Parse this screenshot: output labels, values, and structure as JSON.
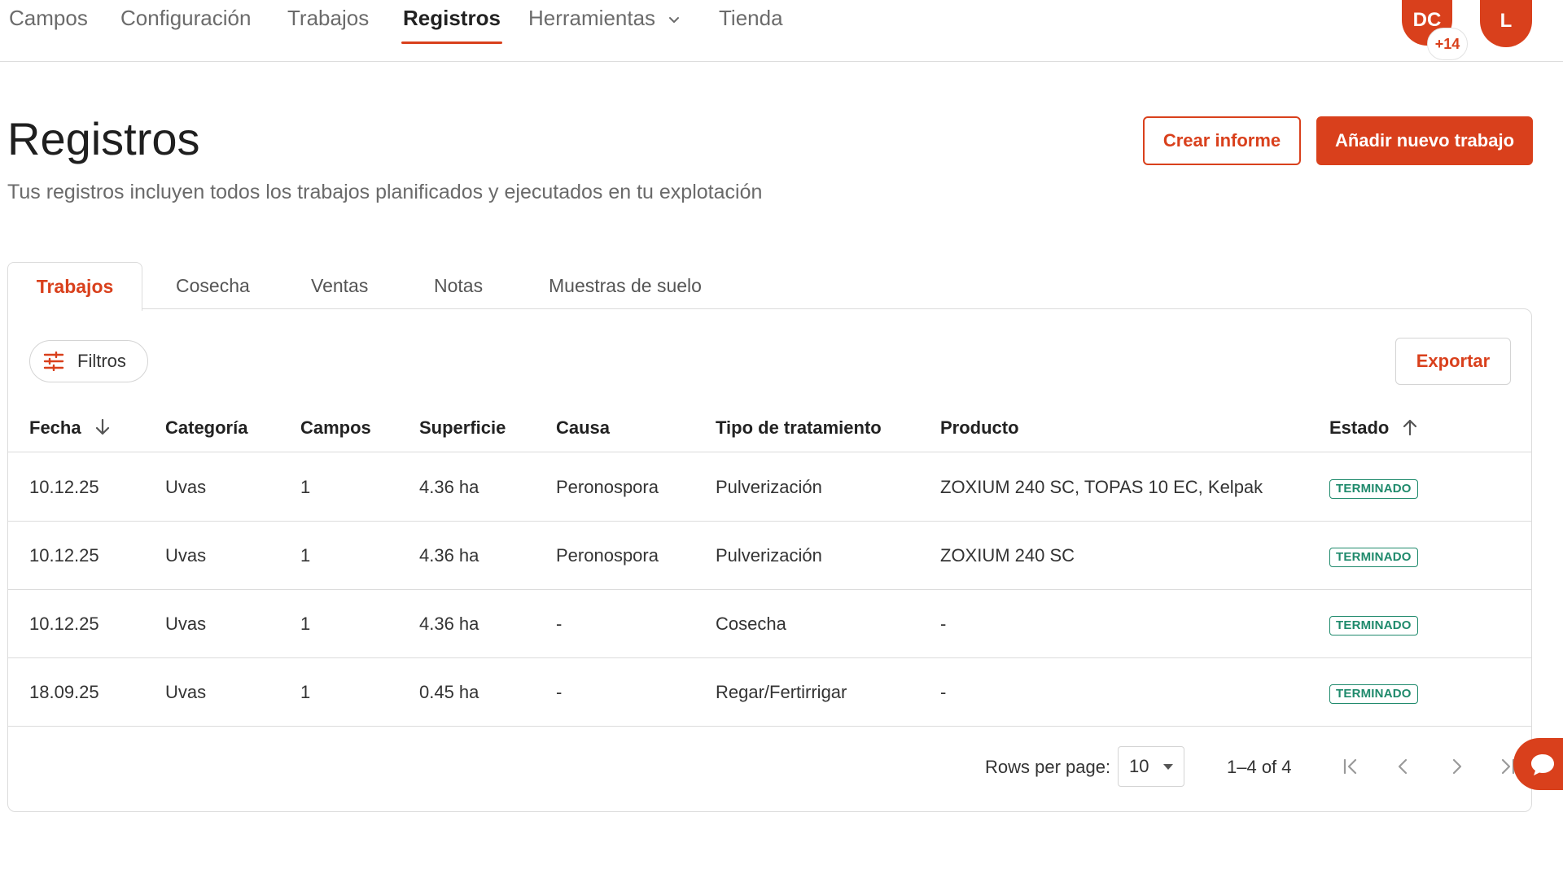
{
  "nav": {
    "items": [
      {
        "label": "Campos",
        "active": false
      },
      {
        "label": "Configuración",
        "active": false
      },
      {
        "label": "Trabajos",
        "active": false
      },
      {
        "label": "Registros",
        "active": true
      },
      {
        "label": "Herramientas",
        "active": false,
        "has_dropdown": true
      },
      {
        "label": "Tienda",
        "active": false
      }
    ],
    "avatars": {
      "primary_initials": "DC",
      "extra_count": "+14",
      "user_initial": "L"
    }
  },
  "header": {
    "title": "Registros",
    "subtitle": "Tus registros incluyen todos los trabajos planificados y ejecutados en tu explotación",
    "create_report_label": "Crear informe",
    "add_job_label": "Añadir nuevo trabajo"
  },
  "tabs": [
    {
      "label": "Trabajos",
      "active": true
    },
    {
      "label": "Cosecha",
      "active": false
    },
    {
      "label": "Ventas",
      "active": false
    },
    {
      "label": "Notas",
      "active": false
    },
    {
      "label": "Muestras de suelo",
      "active": false
    }
  ],
  "toolbar": {
    "filters_label": "Filtros",
    "export_label": "Exportar"
  },
  "table": {
    "columns": [
      {
        "label": "Fecha",
        "sort": "desc"
      },
      {
        "label": "Categoría"
      },
      {
        "label": "Campos"
      },
      {
        "label": "Superficie"
      },
      {
        "label": "Causa"
      },
      {
        "label": "Tipo de tratamiento"
      },
      {
        "label": "Producto"
      },
      {
        "label": "Estado",
        "sort": "asc"
      }
    ],
    "rows": [
      {
        "fecha": "10.12.25",
        "categoria": "Uvas",
        "campos": "1",
        "superficie": "4.36 ha",
        "causa": "Peronospora",
        "tipo": "Pulverización",
        "producto": "ZOXIUM 240 SC, TOPAS 10 EC, Kelpak",
        "estado": "TERMINADO"
      },
      {
        "fecha": "10.12.25",
        "categoria": "Uvas",
        "campos": "1",
        "superficie": "4.36 ha",
        "causa": "Peronospora",
        "tipo": "Pulverización",
        "producto": "ZOXIUM 240 SC",
        "estado": "TERMINADO"
      },
      {
        "fecha": "10.12.25",
        "categoria": "Uvas",
        "campos": "1",
        "superficie": "4.36 ha",
        "causa": "-",
        "tipo": "Cosecha",
        "producto": "-",
        "estado": "TERMINADO"
      },
      {
        "fecha": "18.09.25",
        "categoria": "Uvas",
        "campos": "1",
        "superficie": "0.45 ha",
        "causa": "-",
        "tipo": "Regar/Fertirrigar",
        "producto": "-",
        "estado": "TERMINADO"
      }
    ]
  },
  "pagination": {
    "rows_per_page_label": "Rows per page:",
    "rows_per_page_value": "10",
    "range_text": "1–4 of 4"
  },
  "colors": {
    "accent": "#d9401c",
    "status_done": "#1f8a6c",
    "border": "#dcdcdc"
  }
}
